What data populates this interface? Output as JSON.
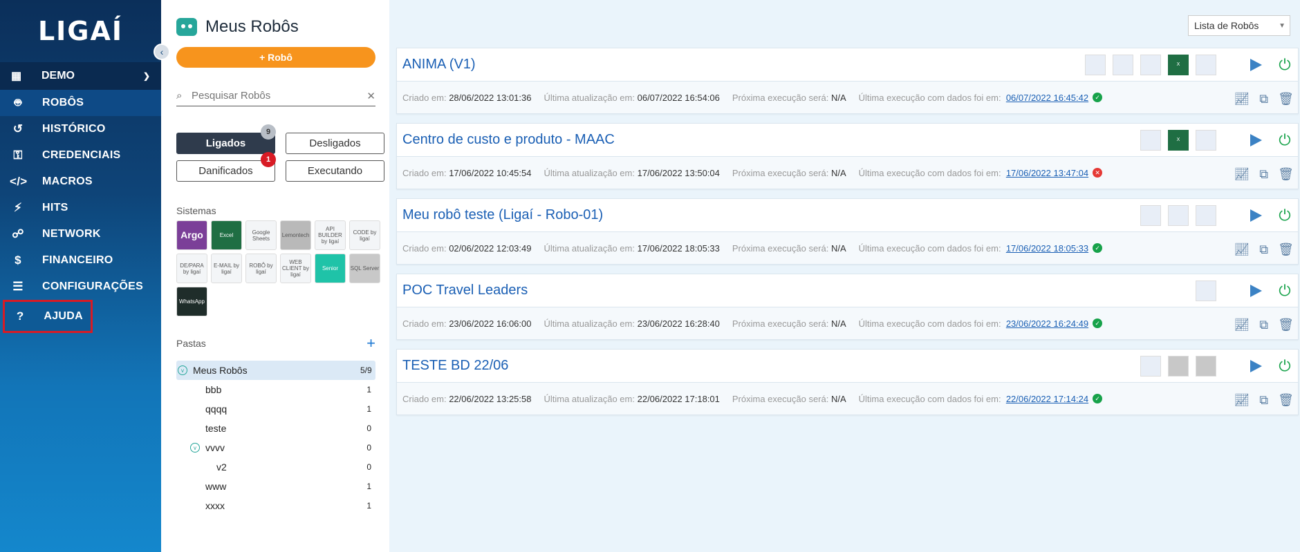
{
  "sidebar": {
    "logo": "LIGAÍ",
    "org": {
      "label": "DEMO"
    },
    "items": [
      {
        "label": "ROBÔS",
        "icon": "robot-icon"
      },
      {
        "label": "HISTÓRICO",
        "icon": "history-icon"
      },
      {
        "label": "CREDENCIAIS",
        "icon": "key-icon"
      },
      {
        "label": "MACROS",
        "icon": "code-icon"
      },
      {
        "label": "HITS",
        "icon": "bolt-icon"
      },
      {
        "label": "NETWORK",
        "icon": "network-icon"
      },
      {
        "label": "FINANCEIRO",
        "icon": "invoice-icon"
      },
      {
        "label": "CONFIGURAÇÕES",
        "icon": "sliders-icon"
      },
      {
        "label": "AJUDA",
        "icon": "help-icon"
      }
    ]
  },
  "panel": {
    "title": "Meus Robôs",
    "add_button": "+ Robô",
    "search_placeholder": "Pesquisar Robôs",
    "filters": [
      {
        "label": "Ligados",
        "badge": "9"
      },
      {
        "label": "Desligados",
        "badge": ""
      },
      {
        "label": "Danificados",
        "badge": "1"
      },
      {
        "label": "Executando",
        "badge": ""
      }
    ],
    "systems_title": "Sistemas",
    "systems": [
      "Argo",
      "Excel",
      "Google Sheets",
      "Lemontech",
      "API BUILDER by ligaí",
      "CODE by ligaí",
      "DE/PARA by ligaí",
      "E-MAIL by ligaí",
      "ROBÔ by ligaí",
      "WEB CLIENT by ligaí",
      "Senior",
      "SQL Server",
      "WhatsApp"
    ],
    "folders_title": "Pastas",
    "folders": [
      {
        "name": "Meus Robôs",
        "count": "5/9"
      },
      {
        "name": "bbb",
        "count": "1"
      },
      {
        "name": "qqqq",
        "count": "1"
      },
      {
        "name": "teste",
        "count": "0"
      },
      {
        "name": "vvvv",
        "count": "0"
      },
      {
        "name": "v2",
        "count": "0"
      },
      {
        "name": "www",
        "count": "1"
      },
      {
        "name": "xxxx",
        "count": "1"
      }
    ]
  },
  "view_select": "Lista de Robôs",
  "labels": {
    "created": "Criado em:",
    "updated": "Última atualização em:",
    "next": "Próxima execução será:",
    "last": "Última execução com dados foi em:"
  },
  "robots": [
    {
      "name": "ANIMA (V1)",
      "created": "28/06/2022 13:01:36",
      "updated": "06/07/2022 16:54:06",
      "next": "N/A",
      "last": "06/07/2022 16:45:42",
      "status": "ok"
    },
    {
      "name": "Centro de custo e produto - MAAC",
      "created": "17/06/2022 10:45:54",
      "updated": "17/06/2022 13:50:04",
      "next": "N/A",
      "last": "17/06/2022 13:47:04",
      "status": "error"
    },
    {
      "name": "Meu robô teste (Ligaí - Robo-01)",
      "created": "02/06/2022 12:03:49",
      "updated": "17/06/2022 18:05:33",
      "next": "N/A",
      "last": "17/06/2022 18:05:33",
      "status": "ok"
    },
    {
      "name": "POC Travel Leaders",
      "created": "23/06/2022 16:06:00",
      "updated": "23/06/2022 16:28:40",
      "next": "N/A",
      "last": "23/06/2022 16:24:49",
      "status": "ok"
    },
    {
      "name": "TESTE BD 22/06",
      "created": "22/06/2022 13:25:58",
      "updated": "22/06/2022 17:18:01",
      "next": "N/A",
      "last": "22/06/2022 17:14:24",
      "status": "ok"
    }
  ]
}
